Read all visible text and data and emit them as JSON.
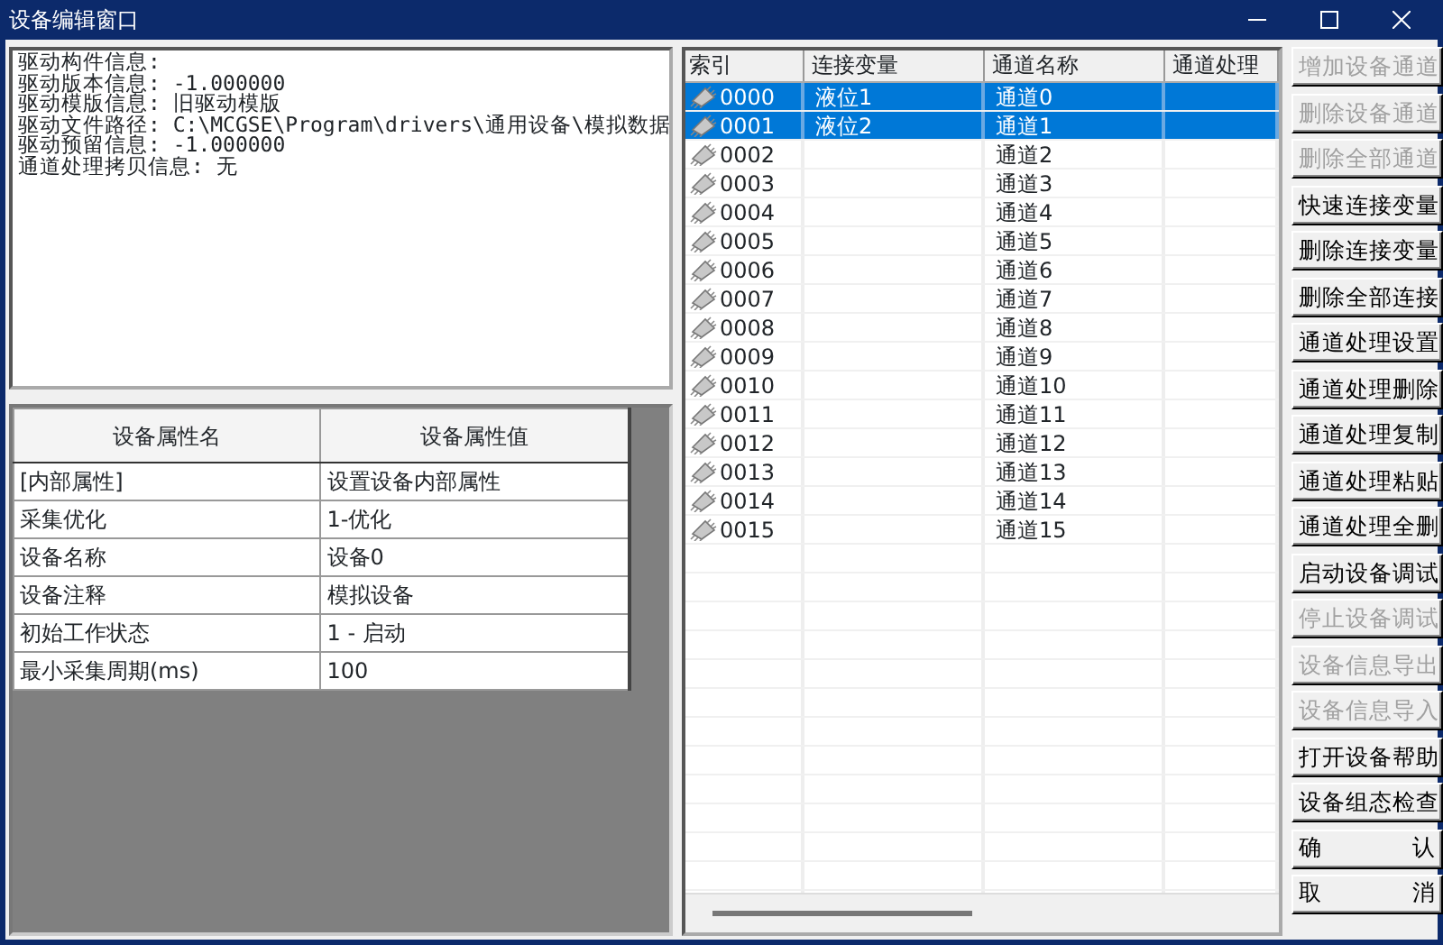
{
  "window": {
    "title": "设备编辑窗口"
  },
  "info_lines": [
    "驱动构件信息:",
    "驱动版本信息: -1.000000",
    "驱动模版信息: 旧驱动模版",
    "驱动文件路径: C:\\MCGSE\\Program\\drivers\\通用设备\\模拟数据",
    "驱动预留信息: -1.000000",
    "通道处理拷贝信息: 无"
  ],
  "properties": {
    "columns": [
      "设备属性名",
      "设备属性值"
    ],
    "rows": [
      [
        "[内部属性]",
        "设置设备内部属性"
      ],
      [
        "采集优化",
        "1-优化"
      ],
      [
        "设备名称",
        "设备0"
      ],
      [
        "设备注释",
        "模拟设备"
      ],
      [
        "初始工作状态",
        "1 - 启动"
      ],
      [
        "最小采集周期(ms)",
        "100"
      ]
    ]
  },
  "channels": {
    "columns": [
      "索引",
      "连接变量",
      "通道名称",
      "通道处理"
    ],
    "rows": [
      {
        "index": "0000",
        "variable": "液位1",
        "name": "通道0",
        "selected": true
      },
      {
        "index": "0001",
        "variable": "液位2",
        "name": "通道1",
        "selected": true
      },
      {
        "index": "0002",
        "name": "通道2",
        "selected": false
      },
      {
        "index": "0003",
        "name": "通道3",
        "selected": false
      },
      {
        "index": "0004",
        "name": "通道4",
        "selected": false
      },
      {
        "index": "0005",
        "name": "通道5",
        "selected": false
      },
      {
        "index": "0006",
        "name": "通道6",
        "selected": false
      },
      {
        "index": "0007",
        "name": "通道7",
        "selected": false
      },
      {
        "index": "0008",
        "name": "通道8",
        "selected": false
      },
      {
        "index": "0009",
        "name": "通道9",
        "selected": false
      },
      {
        "index": "0010",
        "name": "通道10",
        "selected": false
      },
      {
        "index": "0011",
        "name": "通道11",
        "selected": false
      },
      {
        "index": "0012",
        "name": "通道12",
        "selected": false
      },
      {
        "index": "0013",
        "name": "通道13",
        "selected": false
      },
      {
        "index": "0014",
        "name": "通道14",
        "selected": false
      },
      {
        "index": "0015",
        "name": "通道15",
        "selected": false
      }
    ]
  },
  "buttons": [
    {
      "label": "增加设备通道",
      "disabled": true
    },
    {
      "label": "删除设备通道",
      "disabled": true
    },
    {
      "label": "删除全部通道",
      "disabled": true
    },
    {
      "label": "快速连接变量",
      "disabled": false
    },
    {
      "label": "删除连接变量",
      "disabled": false
    },
    {
      "label": "删除全部连接",
      "disabled": false
    },
    {
      "label": "通道处理设置",
      "disabled": false
    },
    {
      "label": "通道处理删除",
      "disabled": false
    },
    {
      "label": "通道处理复制",
      "disabled": false
    },
    {
      "label": "通道处理粘贴",
      "disabled": false
    },
    {
      "label": "通道处理全删",
      "disabled": false
    },
    {
      "label": "启动设备调试",
      "disabled": false
    },
    {
      "label": "停止设备调试",
      "disabled": true
    },
    {
      "label": "设备信息导出",
      "disabled": true
    },
    {
      "label": "设备信息导入",
      "disabled": true
    },
    {
      "label": "打开设备帮助",
      "disabled": false
    },
    {
      "label": "设备组态检查",
      "disabled": false
    },
    {
      "label": "确 认",
      "disabled": false
    },
    {
      "label": "取 消",
      "disabled": false
    }
  ]
}
